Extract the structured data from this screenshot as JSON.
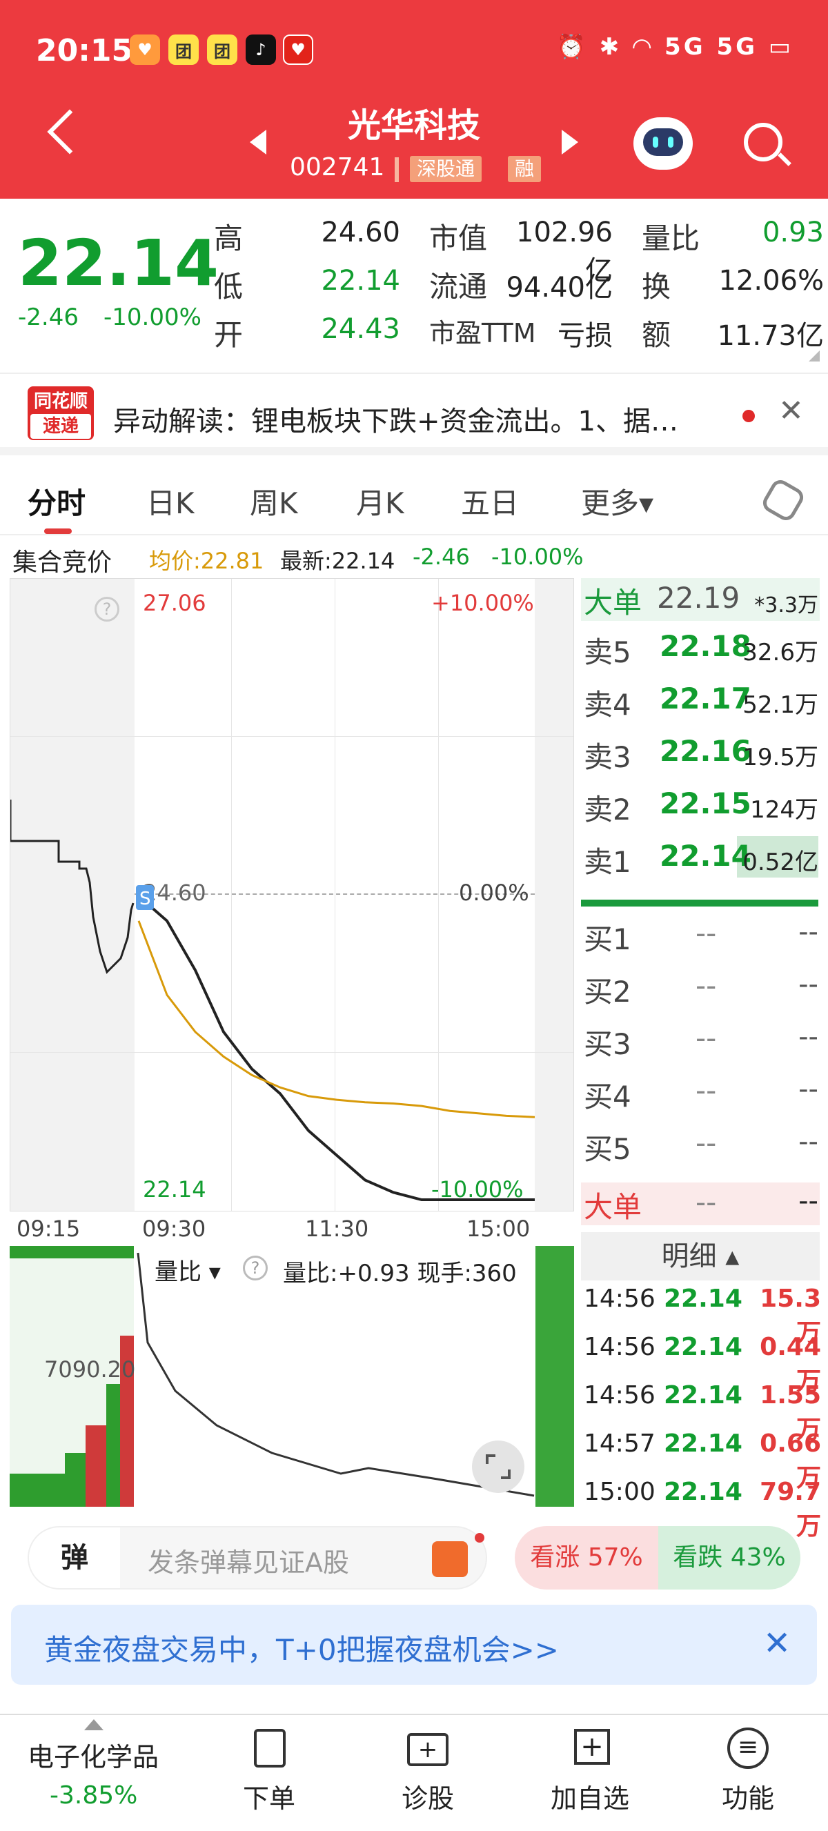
{
  "status_bar": {
    "time": "20:15",
    "right": "⏰ ✱ ◠ 5G 5G ▭"
  },
  "header": {
    "title": "光华科技",
    "code": "002741",
    "tag1": "深股通",
    "tag2": "融"
  },
  "quote": {
    "price": "22.14",
    "change": "-2.46",
    "change_pct": "-10.00%",
    "high_label": "高",
    "high": "24.60",
    "low_label": "低",
    "low": "22.14",
    "open_label": "开",
    "open": "24.43",
    "mktcap_label": "市值",
    "mktcap": "102.96亿",
    "float_label": "流通",
    "float": "94.40亿",
    "pe_label": "市盈TTM",
    "pe": "亏损",
    "vr_label": "量比",
    "vr": "0.93",
    "turn_label": "换",
    "turn": "12.06%",
    "amt_label": "额",
    "amt": "11.73亿"
  },
  "news": {
    "badge1": "同花顺",
    "badge2": "速递",
    "text": "异动解读：锂电板块下跌+资金流出。1、据…"
  },
  "tabs": [
    "分时",
    "日K",
    "周K",
    "月K",
    "五日",
    "更多▾"
  ],
  "chart_info": {
    "label": "集合竞价",
    "avg": "均价:22.81",
    "latest": "最新:22.14",
    "chg": "-2.46",
    "pct": "-10.00%"
  },
  "chart_data": {
    "type": "line",
    "x_ticks": [
      "09:15",
      "09:30",
      "11:30",
      "15:00"
    ],
    "y_left_top": "27.06",
    "y_left_mid": "24.60",
    "y_left_bottom": "22.14",
    "y_right_top": "+10.00%",
    "y_right_mid": "0.00%",
    "y_right_bottom": "-10.00%",
    "ylim": [
      22.14,
      27.06
    ],
    "series": [
      {
        "name": "price",
        "values": [
          24.6,
          24.4,
          24.0,
          23.5,
          23.2,
          23.0,
          22.7,
          22.5,
          22.3,
          22.2,
          22.14,
          22.14,
          22.14,
          22.14,
          22.14
        ]
      },
      {
        "name": "均价",
        "values": [
          24.4,
          23.8,
          23.5,
          23.3,
          23.15,
          23.05,
          22.98,
          22.95,
          22.93,
          22.92,
          22.9,
          22.86,
          22.84,
          22.82,
          22.81
        ]
      }
    ],
    "sub_label": "量比",
    "sub_info": "量比:+0.93 现手:360",
    "sub_value": "7090.20"
  },
  "orderbook": {
    "big_label": "大单",
    "big_price": "22.19",
    "big_vol": "*3.3万",
    "asks": [
      {
        "label": "卖5",
        "price": "22.18",
        "vol": "32.6万"
      },
      {
        "label": "卖4",
        "price": "22.17",
        "vol": "52.1万"
      },
      {
        "label": "卖3",
        "price": "22.16",
        "vol": "19.5万"
      },
      {
        "label": "卖2",
        "price": "22.15",
        "vol": "124万"
      },
      {
        "label": "卖1",
        "price": "22.14",
        "vol": "0.52亿"
      }
    ],
    "bids": [
      {
        "label": "买1",
        "price": "--",
        "vol": "--"
      },
      {
        "label": "买2",
        "price": "--",
        "vol": "--"
      },
      {
        "label": "买3",
        "price": "--",
        "vol": "--"
      },
      {
        "label": "买4",
        "price": "--",
        "vol": "--"
      },
      {
        "label": "买5",
        "price": "--",
        "vol": "--"
      }
    ],
    "big2_label": "大单",
    "big2_price": "--",
    "big2_vol": "--",
    "detail_label": "明细 ▴",
    "trades": [
      {
        "time": "14:56",
        "price": "22.14",
        "vol": "15.3万"
      },
      {
        "time": "14:56",
        "price": "22.14",
        "vol": "0.44万"
      },
      {
        "time": "14:56",
        "price": "22.14",
        "vol": "1.55万"
      },
      {
        "time": "14:57",
        "price": "22.14",
        "vol": "0.66万"
      },
      {
        "time": "15:00",
        "price": "22.14",
        "vol": "79.7万"
      }
    ]
  },
  "danmu": {
    "icon": "弹",
    "placeholder": "发条弹幕见证A股",
    "up": "看涨 57%",
    "down": "看跌 43%"
  },
  "banner": {
    "text": "黄金夜盘交易中，T+0把握夜盘机会>>"
  },
  "bottom": {
    "sector": "电子化学品",
    "sector_pct": "-3.85%",
    "items": [
      "下单",
      "诊股",
      "加自选",
      "功能"
    ]
  }
}
